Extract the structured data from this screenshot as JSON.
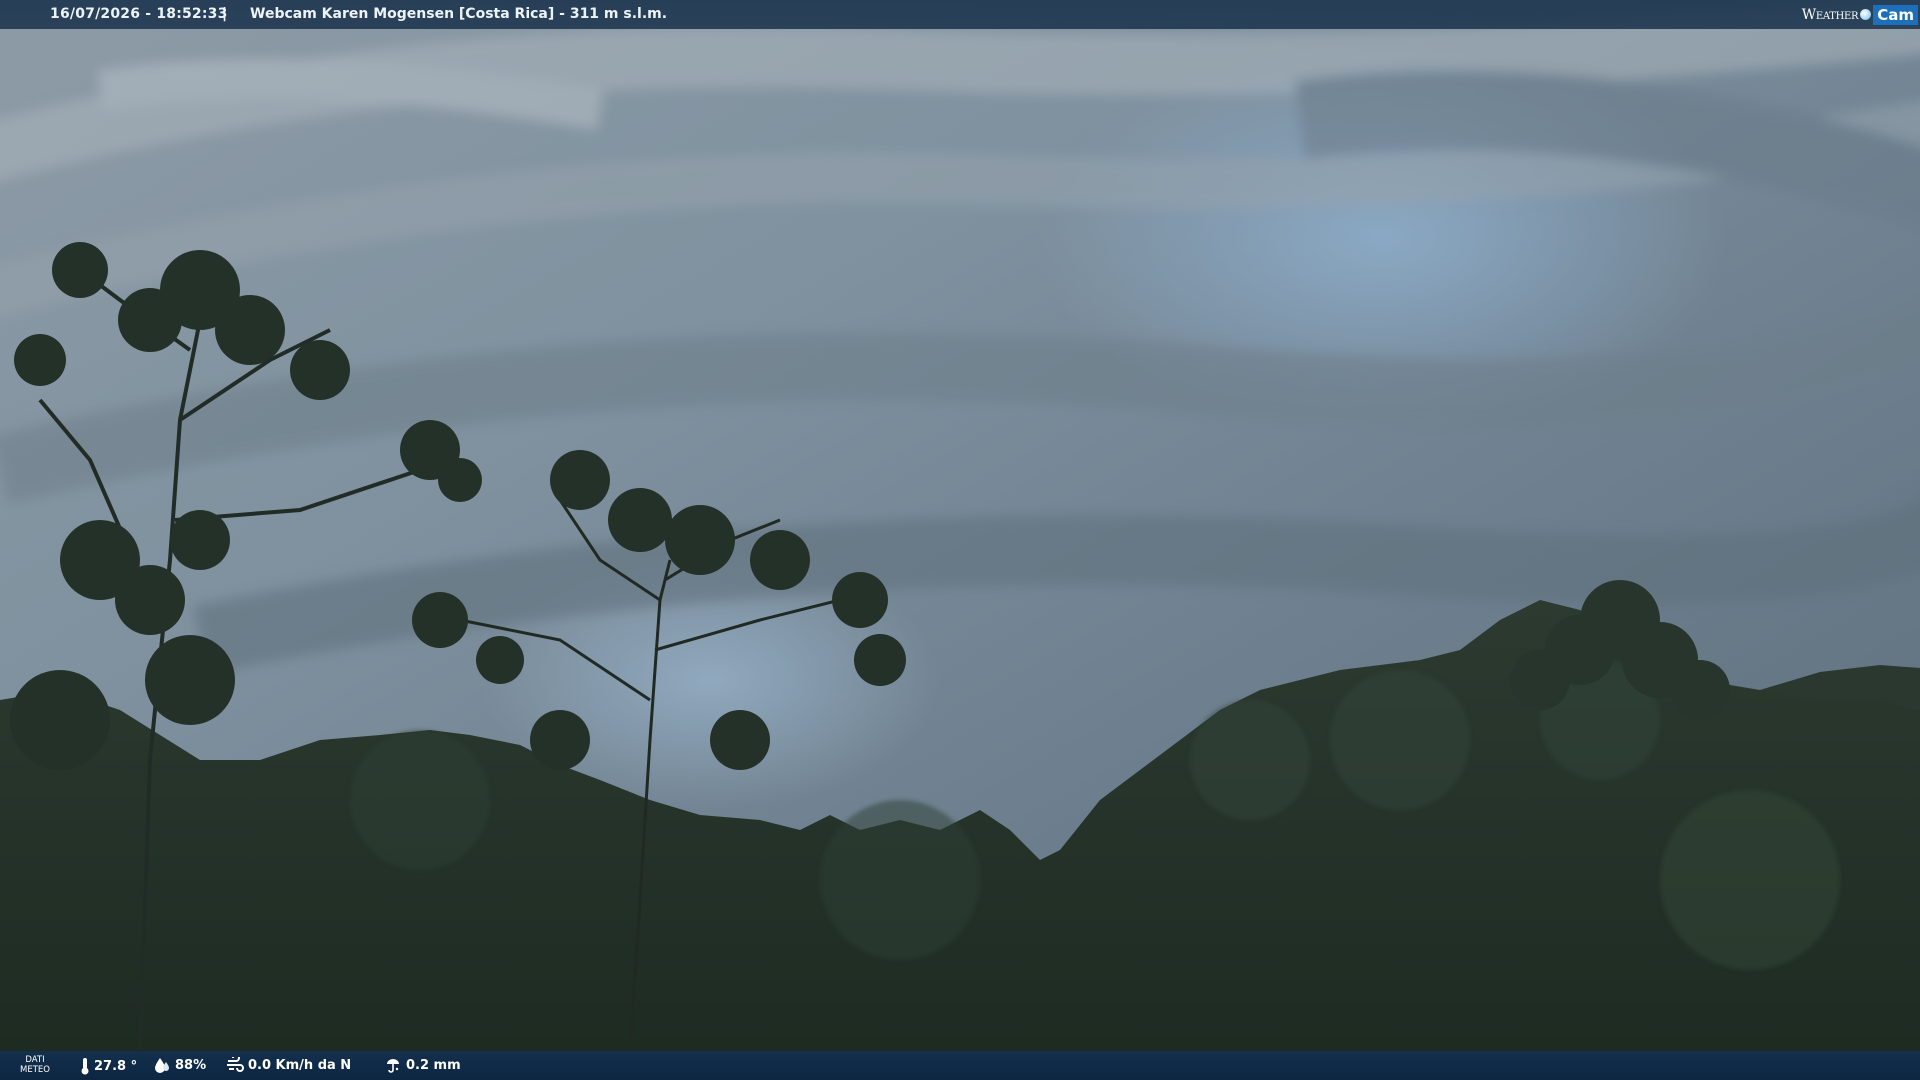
{
  "header": {
    "datetime": "16/07/2026 - 18:52:33",
    "separator": "|",
    "title": "Webcam Karen Mogensen [Costa Rica]  - 311 m s.l.m."
  },
  "logo": {
    "weather": "Weather",
    "cam": "Cam"
  },
  "footer": {
    "label_line1": "DATI",
    "label_line2": "METEO",
    "temperature": "27.8 °",
    "humidity": "88%",
    "wind": "0.0 Km/h da N",
    "rain": "0.2 mm"
  },
  "icons": {
    "temperature": "thermometer-icon",
    "humidity": "humidity-drop-icon",
    "wind": "wind-icon",
    "rain": "rain-gauge-icon"
  },
  "colors": {
    "bar_blue": "#1e3750",
    "logo_blue": "#1c6fb8"
  }
}
